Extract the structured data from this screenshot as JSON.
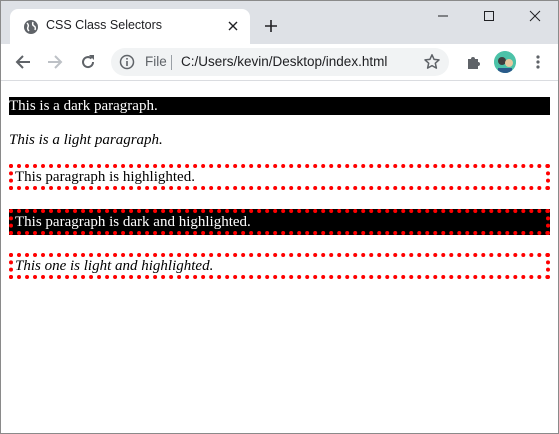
{
  "tab": {
    "title": "CSS Class Selectors",
    "favicon": "globe-icon"
  },
  "toolbar": {
    "file_label": "File",
    "url": "C:/Users/kevin/Desktop/index.html"
  },
  "paragraphs": {
    "dark": "This is a dark paragraph.",
    "light": "This is a light paragraph.",
    "highlighted": "This paragraph is highlighted.",
    "dark_highlighted": "This paragraph is dark and highlighted.",
    "light_highlighted": "This one is light and highlighted."
  },
  "colors": {
    "tabstrip": "#dee1e6",
    "highlight_border": "#ff0000",
    "dark_bg": "#000000",
    "avatar_bg": "#4cc2a8"
  }
}
